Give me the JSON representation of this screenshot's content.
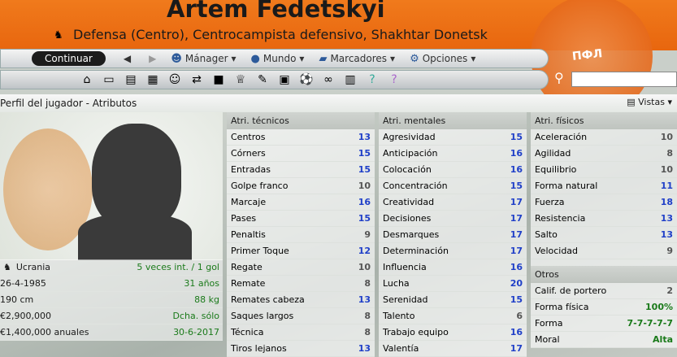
{
  "header": {
    "name": "Artem Fedetskyi",
    "subtitle": "Defensa (Centro), Centrocampista defensivo, Shakhtar Donetsk",
    "crest_text": "ПФЛ"
  },
  "nav": {
    "continue": "Continuar",
    "items": [
      "Mánager",
      "Mundo",
      "Marcadores",
      "Opciones"
    ]
  },
  "bar": {
    "title": "Perfil del jugador - Atributos",
    "vistas": "Vistas"
  },
  "info": [
    {
      "l": "Ucrania",
      "r": "5 veces int. / 1 gol"
    },
    {
      "l": "26-4-1985",
      "r": "31 años"
    },
    {
      "l": "190 cm",
      "r": "88 kg"
    },
    {
      "l": "€2,900,000",
      "r": "Dcha. sólo"
    },
    {
      "l": "€1,400,000 anuales",
      "r": "30-6-2017"
    }
  ],
  "tecnicos": {
    "title": "Atri. técnicos",
    "rows": [
      [
        "Centros",
        "13"
      ],
      [
        "Córners",
        "15"
      ],
      [
        "Entradas",
        "15"
      ],
      [
        "Golpe franco",
        "10"
      ],
      [
        "Marcaje",
        "16"
      ],
      [
        "Pases",
        "15"
      ],
      [
        "Penaltis",
        "9"
      ],
      [
        "Primer Toque",
        "12"
      ],
      [
        "Regate",
        "10"
      ],
      [
        "Remate",
        "8"
      ],
      [
        "Remates cabeza",
        "13"
      ],
      [
        "Saques largos",
        "8"
      ],
      [
        "Técnica",
        "8"
      ],
      [
        "Tiros lejanos",
        "13"
      ]
    ]
  },
  "mentales": {
    "title": "Atri. mentales",
    "rows": [
      [
        "Agresividad",
        "15"
      ],
      [
        "Anticipación",
        "16"
      ],
      [
        "Colocación",
        "16"
      ],
      [
        "Concentración",
        "15"
      ],
      [
        "Creatividad",
        "17"
      ],
      [
        "Decisiones",
        "17"
      ],
      [
        "Desmarques",
        "17"
      ],
      [
        "Determinación",
        "17"
      ],
      [
        "Influencia",
        "16"
      ],
      [
        "Lucha",
        "20"
      ],
      [
        "Serenidad",
        "15"
      ],
      [
        "Talento",
        "6"
      ],
      [
        "Trabajo equipo",
        "16"
      ],
      [
        "Valentía",
        "17"
      ]
    ]
  },
  "fisicos": {
    "title": "Atri. físicos",
    "rows": [
      [
        "Aceleración",
        "10"
      ],
      [
        "Agilidad",
        "8"
      ],
      [
        "Equilibrio",
        "10"
      ],
      [
        "Forma natural",
        "11"
      ],
      [
        "Fuerza",
        "18"
      ],
      [
        "Resistencia",
        "13"
      ],
      [
        "Salto",
        "13"
      ],
      [
        "Velocidad",
        "9"
      ]
    ]
  },
  "otros": {
    "title": "Otros",
    "rows": [
      [
        "Calif. de portero",
        "2"
      ],
      [
        "Forma física",
        "100%"
      ],
      [
        "Forma",
        "7-7-7-7-7"
      ],
      [
        "Moral",
        "Alta"
      ]
    ]
  }
}
